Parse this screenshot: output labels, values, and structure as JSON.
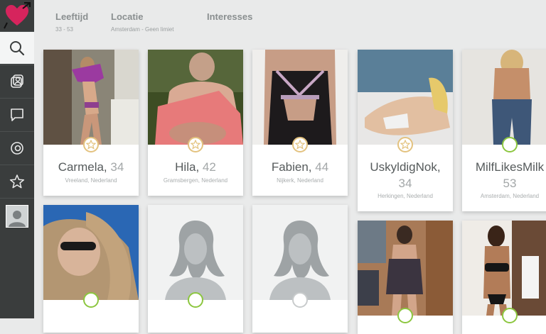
{
  "filters": [
    {
      "label": "Leeftijd",
      "value": "33 - 53"
    },
    {
      "label": "Locatie",
      "value": "Amsterdam - Geen limiet"
    },
    {
      "label": "Interesses",
      "value": ""
    }
  ],
  "sidebar": {
    "items": [
      {
        "icon": "search-icon",
        "active": true
      },
      {
        "icon": "visitors-icon",
        "active": false
      },
      {
        "icon": "chat-icon",
        "active": false
      },
      {
        "icon": "eye-icon",
        "active": false
      },
      {
        "icon": "star-icon",
        "active": false
      },
      {
        "icon": "user-avatar",
        "active": false
      }
    ]
  },
  "colors": {
    "sidebar": "#3a3d3d",
    "background": "#e9eaea",
    "brand": "#d6245d",
    "online": "#8cc63f",
    "favorite": "#e3c27e"
  },
  "profiles": [
    {
      "name": "Carmela,",
      "age": "34",
      "location": "Vreeland, Nederland",
      "badge": "star"
    },
    {
      "name": "Hila,",
      "age": "42",
      "location": "Gramsbergen, Nederland",
      "badge": "star"
    },
    {
      "name": "Fabien,",
      "age": "44",
      "location": "Nijkerk, Nederland",
      "badge": "star"
    },
    {
      "name": "UskyldigNok,",
      "age": "34",
      "location": "Herkingen, Nederland",
      "badge": "star"
    },
    {
      "name": "MilfLikesMilk",
      "age": "53",
      "location": "Amsterdam, Nederland",
      "badge": "online"
    }
  ],
  "profiles_row2": [
    {
      "badge": "online",
      "photo": "photo"
    },
    {
      "badge": "online",
      "photo": "silhouette"
    },
    {
      "badge": "offline",
      "photo": "silhouette"
    },
    {
      "badge": "online",
      "photo": "photo"
    },
    {
      "badge": "online",
      "photo": "photo"
    }
  ]
}
